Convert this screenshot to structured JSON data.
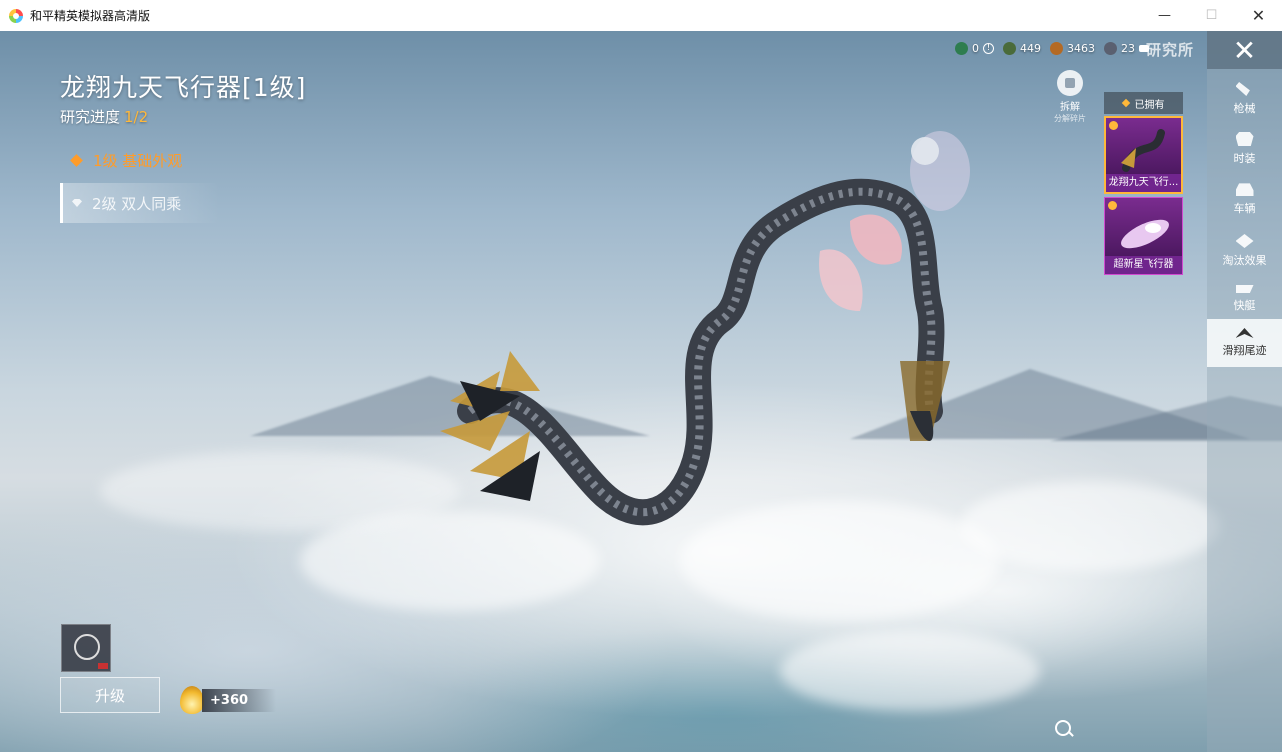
{
  "window": {
    "title": "和平精英模拟器高清版",
    "controls": [
      "—",
      "☐",
      "✕"
    ]
  },
  "item": {
    "title": "龙翔九天飞行器[1级]",
    "progress_label": "研究进度",
    "progress_value": "1/2"
  },
  "levels": [
    {
      "label": "1级 基础外观",
      "state": "current",
      "color": "#ff9c2a"
    },
    {
      "label": "2级 双人同乘",
      "state": "locked"
    }
  ],
  "currency": [
    {
      "icon": "green-emblem-icon",
      "value": "0",
      "color": "#2e7d4f"
    },
    {
      "icon": "green-gem-icon",
      "value": "449",
      "color": "#4a6b3a"
    },
    {
      "icon": "bronze-coin-icon",
      "value": "3463",
      "color": "#b46a24"
    },
    {
      "icon": "research-token-icon",
      "value": "23",
      "color": "#5a6070"
    }
  ],
  "research_link": "研究所",
  "disassemble": {
    "label": "拆解",
    "sub": "分解碎片"
  },
  "owned": {
    "label": "已拥有",
    "cards": [
      {
        "name": "龙翔九天飞行...",
        "selected": true
      },
      {
        "name": "超新星飞行器",
        "selected": false
      }
    ]
  },
  "sidebar": {
    "close_icon": "✕",
    "items": [
      {
        "label": "枪械",
        "icon": "gun-icon",
        "active": false
      },
      {
        "label": "时装",
        "icon": "outfit-icon",
        "active": false
      },
      {
        "label": "车辆",
        "icon": "car-icon",
        "active": false
      },
      {
        "label": "淘汰效果",
        "icon": "elimination-effect-icon",
        "active": false
      },
      {
        "label": "快艇",
        "icon": "speedboat-icon",
        "active": false
      },
      {
        "label": "滑翔尾迹",
        "icon": "glider-trail-icon",
        "active": true
      }
    ]
  },
  "upgrade": {
    "label": "升级"
  },
  "reward": {
    "value": "+360",
    "icon": "flame-icon"
  },
  "zoom_icon": "zoom-in-icon"
}
